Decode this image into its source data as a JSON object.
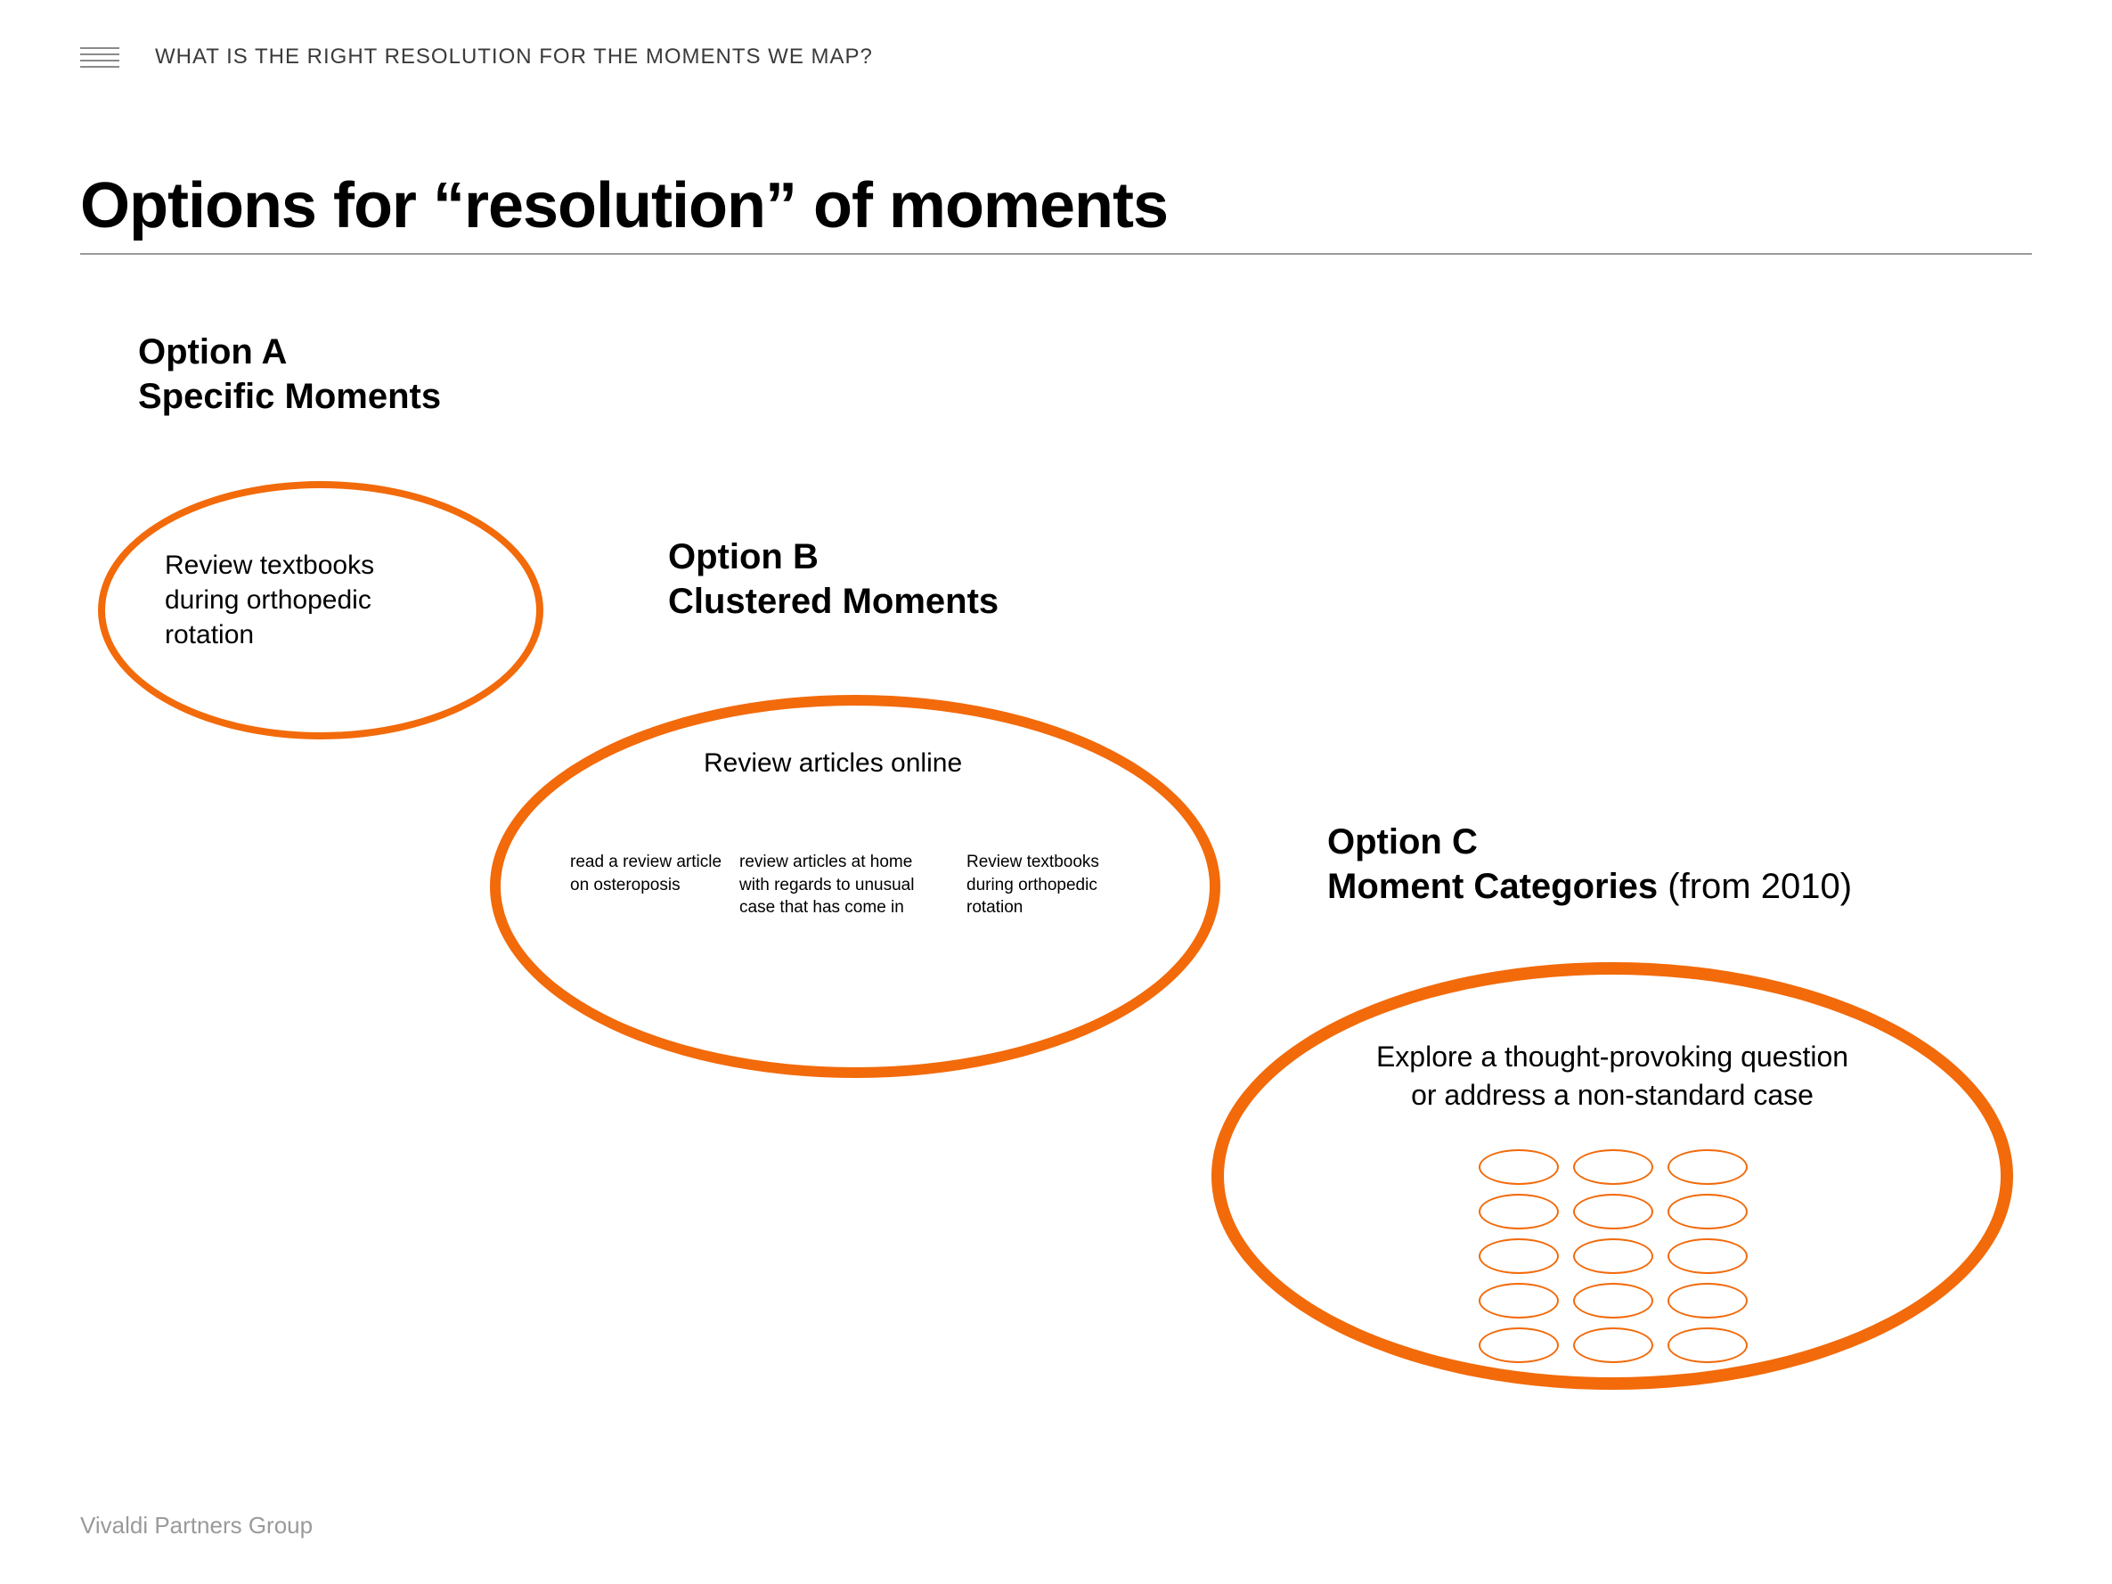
{
  "header": {
    "kicker": "WHAT IS THE RIGHT RESOLUTION FOR THE MOMENTS WE MAP?"
  },
  "title": "Options for “resolution” of moments",
  "optionA": {
    "heading_line1": "Option A",
    "heading_line2": "Specific Moments",
    "bubble_text": "Review textbooks during orthopedic rotation"
  },
  "optionB": {
    "heading_line1": "Option B",
    "heading_line2": "Clustered Moments",
    "bubble_title": "Review articles online",
    "items": [
      "read a review article on osteroposis",
      "review articles at home with regards to unusual case that has come in",
      "Review textbooks during orthopedic rotation"
    ]
  },
  "optionC": {
    "heading_line1": "Option C",
    "heading_line2_strong": "Moment Categories",
    "heading_line2_normal": " (from 2010)",
    "bubble_line1": "Explore a thought-provoking question",
    "bubble_line2": "or address a non-standard case",
    "mini_count": 15
  },
  "footer": "Vivaldi Partners Group",
  "colors": {
    "orange": "#f26a0a",
    "grey": "#9a9a9a"
  }
}
